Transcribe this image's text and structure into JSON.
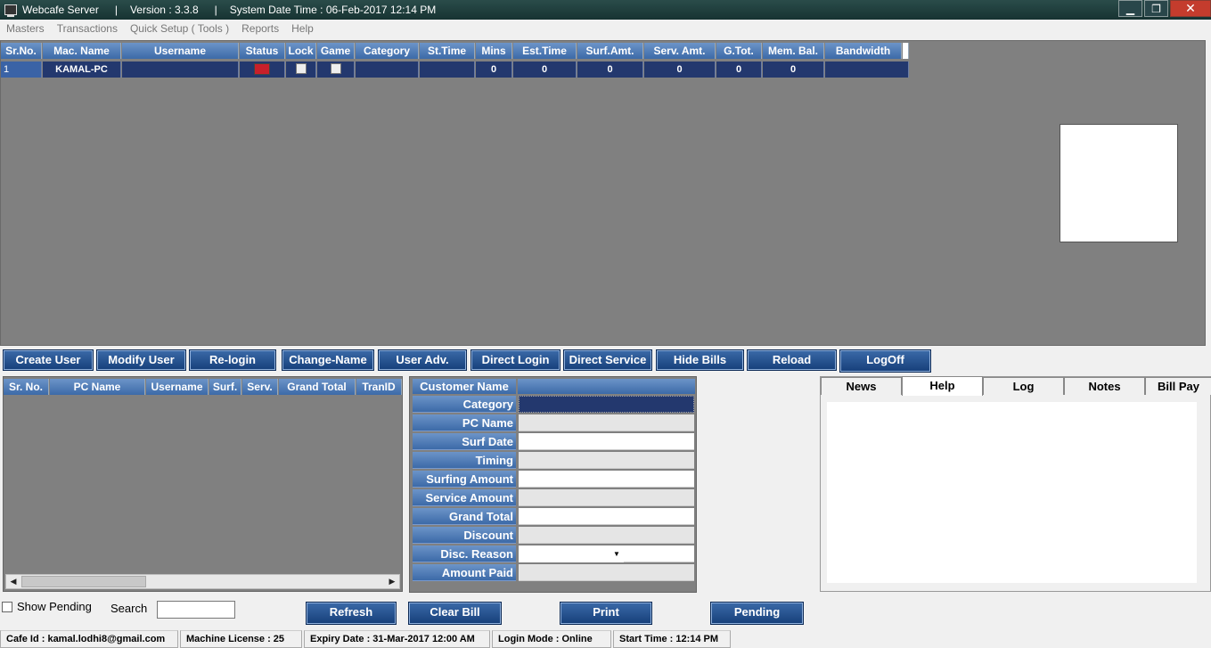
{
  "window": {
    "app_name": "Webcafe Server",
    "version": "Version : 3.3.8",
    "datetime": "System Date Time : 06-Feb-2017 12:14 PM",
    "separator": "|",
    "minimize": "▁",
    "restore": "❐",
    "close": "✕"
  },
  "menu": [
    "Masters",
    "Transactions",
    "Quick Setup ( Tools )",
    "Reports",
    "Help"
  ],
  "top_grid": {
    "headers": [
      "Sr.No.",
      "Mac. Name",
      "Username",
      "Status",
      "Lock",
      "Game",
      "Category",
      "St.Time",
      "Mins",
      "Est.Time",
      "Surf.Amt.",
      "Serv. Amt.",
      "G.Tot.",
      "Mem. Bal.",
      "Bandwidth"
    ],
    "rows": [
      {
        "sr": "1",
        "mac": "KAMAL-PC",
        "username": "",
        "status_color": "#c8202a",
        "lock": false,
        "game": false,
        "category": "",
        "st_time": "",
        "mins": "0",
        "est_time": "0",
        "surf_amt": "0",
        "serv_amt": "0",
        "g_tot": "0",
        "mem_bal": "0",
        "bandwidth": ""
      }
    ]
  },
  "buttons": {
    "create_user": "Create User",
    "modify_user": "Modify User",
    "relogin": "Re-login",
    "change_name": "Change-Name",
    "user_adv": "User Adv.",
    "direct_login": "Direct Login",
    "direct_service": "Direct Service",
    "hide_bills": "Hide Bills",
    "reload": "Reload",
    "logoff": "LogOff",
    "refresh": "Refresh",
    "clear_bill": "Clear Bill",
    "print": "Print",
    "pending": "Pending"
  },
  "bill_list": {
    "headers": [
      "Sr. No.",
      "PC Name",
      "Username",
      "Surf.",
      "Serv.",
      "Grand Total",
      "TranID"
    ],
    "scroll_left": "◀",
    "scroll_right": "▶"
  },
  "customer_form": {
    "header": "Customer Name",
    "fields": [
      "Category",
      "PC Name",
      "Surf Date",
      "Timing",
      "Surfing Amount",
      "Service Amount",
      "Grand Total",
      "Discount",
      "Disc. Reason",
      "Amount Paid"
    ],
    "dropdown_arrow": "▼"
  },
  "tabs": [
    "News",
    "Help",
    "Log",
    "Notes",
    "Bill Pay"
  ],
  "active_tab": "Help",
  "filter": {
    "show_pending": "Show Pending",
    "search_label": "Search",
    "search_value": ""
  },
  "statusbar": {
    "cafe_id": "Cafe Id : kamal.lodhi8@gmail.com",
    "license": "Machine License : 25",
    "expiry": "Expiry Date : 31-Mar-2017 12:00 AM",
    "login_mode": "Login Mode : Online",
    "start_time": "Start Time : 12:14 PM"
  }
}
